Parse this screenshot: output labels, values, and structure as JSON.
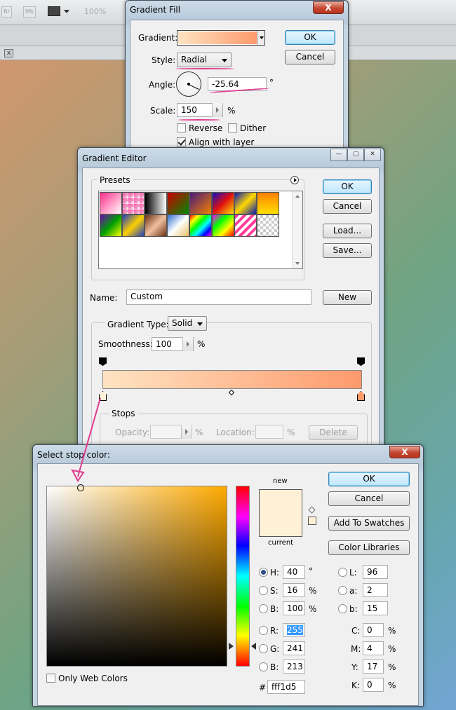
{
  "toolbar": {
    "br_label": "Br",
    "mb_label": "Mb",
    "zoom": "100%"
  },
  "gradient_fill": {
    "title": "Gradient Fill",
    "close_label": "X",
    "gradient_label": "Gradient:",
    "style_label": "Style:",
    "style_value": "Radial",
    "angle_label": "Angle:",
    "angle_value": "-25.64",
    "angle_unit": "°",
    "scale_label": "Scale:",
    "scale_value": "150",
    "scale_unit": "%",
    "reverse_label": "Reverse",
    "dither_label": "Dither",
    "align_label": "Align with layer",
    "ok_label": "OK",
    "cancel_label": "Cancel"
  },
  "gradient_editor": {
    "title": "Gradient Editor",
    "presets_label": "Presets",
    "ok_label": "OK",
    "cancel_label": "Cancel",
    "load_label": "Load...",
    "save_label": "Save...",
    "name_label": "Name:",
    "name_value": "Custom",
    "new_label": "New",
    "gradient_type_label": "Gradient Type:",
    "gradient_type_value": "Solid",
    "smoothness_label": "Smoothness:",
    "smoothness_value": "100",
    "smoothness_unit": "%",
    "stops_label": "Stops",
    "opacity_label": "Opacity:",
    "opacity_unit": "%",
    "location_label": "Location:",
    "location_unit": "%",
    "delete_label": "Delete"
  },
  "color_picker": {
    "title": "Select stop color:",
    "new_label": "new",
    "current_label": "current",
    "ok_label": "OK",
    "cancel_label": "Cancel",
    "add_swatches_label": "Add To Swatches",
    "color_libraries_label": "Color Libraries",
    "only_web_label": "Only Web Colors",
    "h_label": "H:",
    "h_value": "40",
    "h_unit": "°",
    "s_label": "S:",
    "s_value": "16",
    "s_unit": "%",
    "b_label": "B:",
    "b_value": "100",
    "b_unit": "%",
    "r_label": "R:",
    "r_value": "255",
    "g_label": "G:",
    "g_value": "241",
    "bb_label": "B:",
    "bb_value": "213",
    "l_label": "L:",
    "l_value": "96",
    "a_label": "a:",
    "a_value": "2",
    "lab_b_label": "b:",
    "lab_b_value": "15",
    "c_label": "C:",
    "c_value": "0",
    "m_label": "M:",
    "m_value": "4",
    "y_label": "Y:",
    "y_value": "17",
    "k_label": "K:",
    "k_value": "0",
    "cmyk_unit": "%",
    "hex_label": "#",
    "hex_value": "fff1d5"
  },
  "colors": {
    "new_color": "#fff1d5",
    "current_color": "#fff1d5",
    "gradient_start": "#ffe3c2",
    "gradient_end": "#fd9a6c",
    "hue": "#ffaa00"
  }
}
